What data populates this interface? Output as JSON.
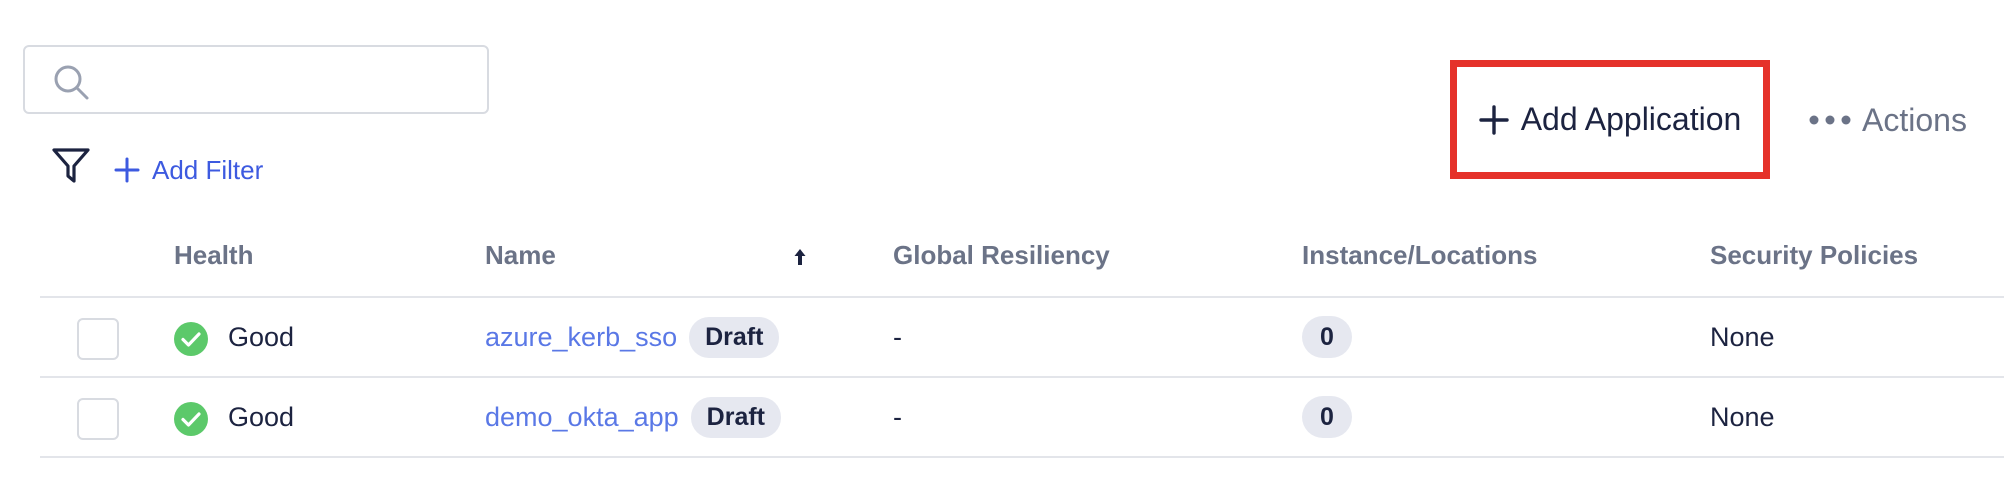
{
  "search": {
    "value": "",
    "placeholder": ""
  },
  "filter": {
    "add_label": "Add Filter"
  },
  "toolbar": {
    "add_application_label": "Add Application",
    "actions_label": "Actions"
  },
  "table": {
    "columns": [
      "Health",
      "Name",
      "Global Resiliency",
      "Instance/Locations",
      "Security Policies"
    ],
    "sort": {
      "column": "Name",
      "direction": "ascending"
    },
    "rows": [
      {
        "health": "Good",
        "name": "azure_kerb_sso",
        "status": "Draft",
        "global_resiliency": "-",
        "instances": "0",
        "security_policies": "None"
      },
      {
        "health": "Good",
        "name": "demo_okta_app",
        "status": "Draft",
        "global_resiliency": "-",
        "instances": "0",
        "security_policies": "None"
      }
    ]
  },
  "colors": {
    "accent": "#3d5ae0",
    "link": "#5a78e6",
    "health_good": "#5cc96a",
    "highlight_border": "#e5322a",
    "badge_bg": "#e6e8f0",
    "header_text": "#6b7387"
  },
  "icons": {
    "search": "search-icon",
    "filter": "filter-icon",
    "add": "plus-icon",
    "actions": "more-horizontal-icon",
    "sort": "sort-ascending-icon",
    "health": "check-circle-icon"
  }
}
